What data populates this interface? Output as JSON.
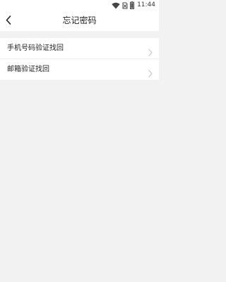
{
  "status_bar": {
    "time": "11:44",
    "icons": [
      "wifi-icon",
      "sim-no-signal-icon",
      "battery-icon"
    ]
  },
  "header": {
    "title": "忘记密码",
    "back_icon": "chevron-left-icon"
  },
  "menu": {
    "items": [
      {
        "label": "手机号码验证找回",
        "icon": "chevron-right-icon"
      },
      {
        "label": "邮箱验证找回",
        "icon": "chevron-right-icon"
      }
    ]
  },
  "colors": {
    "background": "#f2f2f2",
    "surface": "#ffffff",
    "text": "#222222",
    "chevron": "#c8c8c8"
  }
}
